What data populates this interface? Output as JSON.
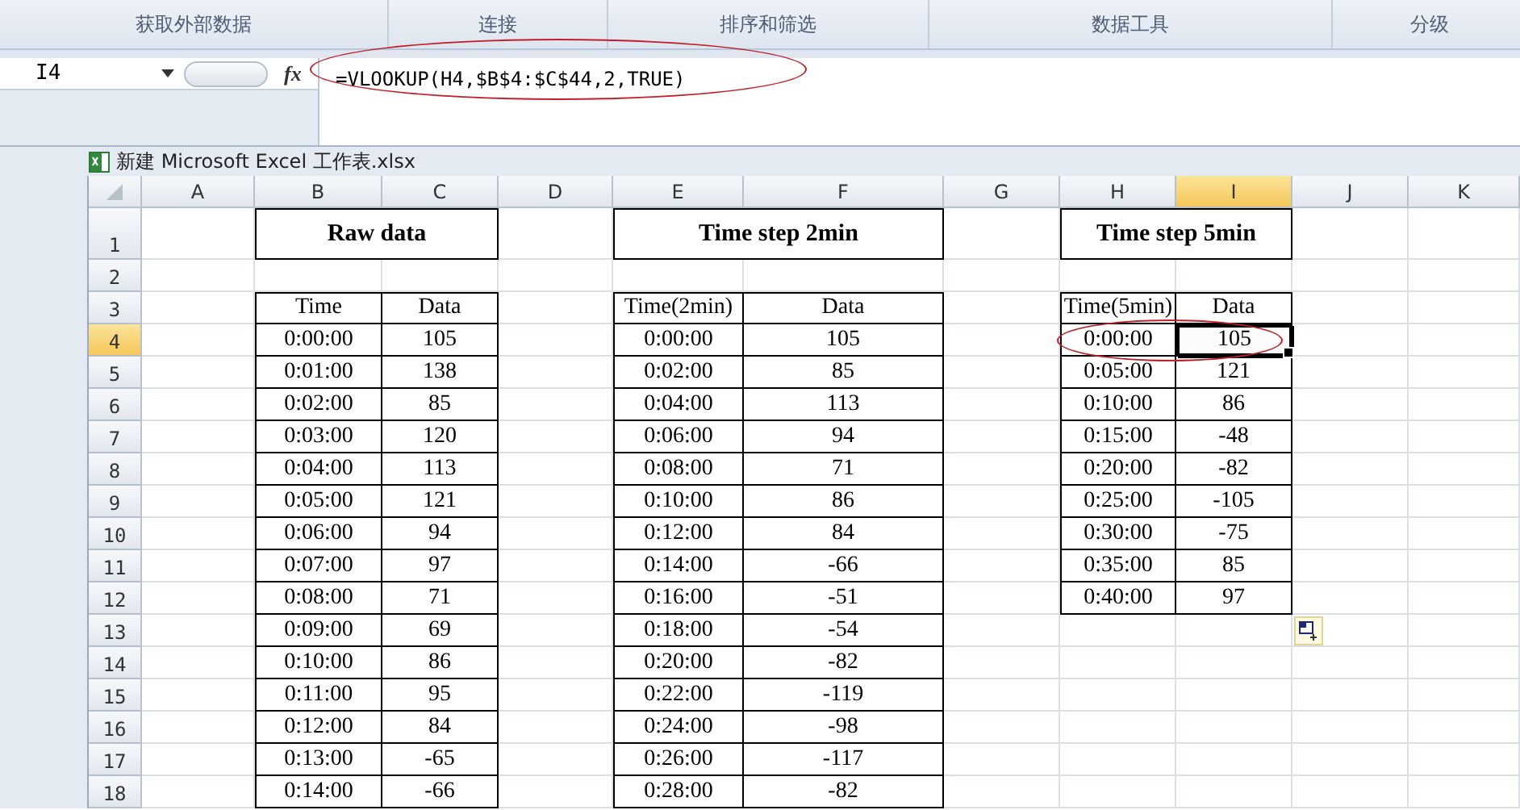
{
  "ribbon_groups": [
    "获取外部数据",
    "连接",
    "排序和筛选",
    "数据工具",
    "分级"
  ],
  "formula_bar": {
    "name_box": "I4",
    "function_label": "fx",
    "formula": "=VLOOKUP(H4,$B$4:$C$44,2,TRUE)",
    "circled": true
  },
  "workbook_title": "新建 Microsoft Excel 工作表.xlsx",
  "sheet": {
    "columns": [
      {
        "label": "A",
        "selected": false
      },
      {
        "label": "B",
        "selected": false
      },
      {
        "label": "C",
        "selected": false
      },
      {
        "label": "D",
        "selected": false
      },
      {
        "label": "E",
        "selected": false
      },
      {
        "label": "F",
        "selected": false
      },
      {
        "label": "G",
        "selected": false
      },
      {
        "label": "H",
        "selected": false
      },
      {
        "label": "I",
        "selected": true
      },
      {
        "label": "J",
        "selected": false
      },
      {
        "label": "K",
        "selected": false
      }
    ],
    "rows": [
      {
        "label": "1",
        "selected": false
      },
      {
        "label": "2",
        "selected": false
      },
      {
        "label": "3",
        "selected": false
      },
      {
        "label": "4",
        "selected": true
      },
      {
        "label": "5",
        "selected": false
      },
      {
        "label": "6",
        "selected": false
      },
      {
        "label": "7",
        "selected": false
      },
      {
        "label": "8",
        "selected": false
      },
      {
        "label": "9",
        "selected": false
      },
      {
        "label": "10",
        "selected": false
      },
      {
        "label": "11",
        "selected": false
      },
      {
        "label": "12",
        "selected": false
      },
      {
        "label": "13",
        "selected": false
      },
      {
        "label": "14",
        "selected": false
      },
      {
        "label": "15",
        "selected": false
      },
      {
        "label": "16",
        "selected": false
      },
      {
        "label": "17",
        "selected": false
      },
      {
        "label": "18",
        "selected": false
      }
    ],
    "tables": [
      {
        "title": "Raw data",
        "headers": [
          "Time",
          "Data"
        ],
        "rows": [
          {
            "time": "0:00:00",
            "data": "105",
            "circled": false,
            "data_selected": false
          },
          {
            "time": "0:01:00",
            "data": "138",
            "circled": false,
            "data_selected": false
          },
          {
            "time": "0:02:00",
            "data": "85",
            "circled": false,
            "data_selected": false
          },
          {
            "time": "0:03:00",
            "data": "120",
            "circled": false,
            "data_selected": false
          },
          {
            "time": "0:04:00",
            "data": "113",
            "circled": false,
            "data_selected": false
          },
          {
            "time": "0:05:00",
            "data": "121",
            "circled": false,
            "data_selected": false
          },
          {
            "time": "0:06:00",
            "data": "94",
            "circled": false,
            "data_selected": false
          },
          {
            "time": "0:07:00",
            "data": "97",
            "circled": false,
            "data_selected": false
          },
          {
            "time": "0:08:00",
            "data": "71",
            "circled": false,
            "data_selected": false
          },
          {
            "time": "0:09:00",
            "data": "69",
            "circled": false,
            "data_selected": false
          },
          {
            "time": "0:10:00",
            "data": "86",
            "circled": false,
            "data_selected": false
          },
          {
            "time": "0:11:00",
            "data": "95",
            "circled": false,
            "data_selected": false
          },
          {
            "time": "0:12:00",
            "data": "84",
            "circled": false,
            "data_selected": false
          },
          {
            "time": "0:13:00",
            "data": "-65",
            "circled": false,
            "data_selected": false
          },
          {
            "time": "0:14:00",
            "data": "-66",
            "circled": false,
            "data_selected": false
          }
        ]
      },
      {
        "title": "Time step 2min",
        "headers": [
          "Time(2min)",
          "Data"
        ],
        "rows": [
          {
            "time": "0:00:00",
            "data": "105",
            "circled": false,
            "data_selected": false
          },
          {
            "time": "0:02:00",
            "data": "85",
            "circled": false,
            "data_selected": false
          },
          {
            "time": "0:04:00",
            "data": "113",
            "circled": false,
            "data_selected": false
          },
          {
            "time": "0:06:00",
            "data": "94",
            "circled": false,
            "data_selected": false
          },
          {
            "time": "0:08:00",
            "data": "71",
            "circled": false,
            "data_selected": false
          },
          {
            "time": "0:10:00",
            "data": "86",
            "circled": false,
            "data_selected": false
          },
          {
            "time": "0:12:00",
            "data": "84",
            "circled": false,
            "data_selected": false
          },
          {
            "time": "0:14:00",
            "data": "-66",
            "circled": false,
            "data_selected": false
          },
          {
            "time": "0:16:00",
            "data": "-51",
            "circled": false,
            "data_selected": false
          },
          {
            "time": "0:18:00",
            "data": "-54",
            "circled": false,
            "data_selected": false
          },
          {
            "time": "0:20:00",
            "data": "-82",
            "circled": false,
            "data_selected": false
          },
          {
            "time": "0:22:00",
            "data": "-119",
            "circled": false,
            "data_selected": false
          },
          {
            "time": "0:24:00",
            "data": "-98",
            "circled": false,
            "data_selected": false
          },
          {
            "time": "0:26:00",
            "data": "-117",
            "circled": false,
            "data_selected": false
          },
          {
            "time": "0:28:00",
            "data": "-82",
            "circled": false,
            "data_selected": false
          }
        ]
      },
      {
        "title": "Time step 5min",
        "headers": [
          "Time(5min)",
          "Data"
        ],
        "rows": [
          {
            "time": "0:00:00",
            "data": "105",
            "circled": true,
            "data_selected": true
          },
          {
            "time": "0:05:00",
            "data": "121",
            "circled": false,
            "data_selected": false
          },
          {
            "time": "0:10:00",
            "data": "86",
            "circled": false,
            "data_selected": false
          },
          {
            "time": "0:15:00",
            "data": "-48",
            "circled": false,
            "data_selected": false
          },
          {
            "time": "0:20:00",
            "data": "-82",
            "circled": false,
            "data_selected": false
          },
          {
            "time": "0:25:00",
            "data": "-105",
            "circled": false,
            "data_selected": false
          },
          {
            "time": "0:30:00",
            "data": "-75",
            "circled": false,
            "data_selected": false
          },
          {
            "time": "0:35:00",
            "data": "85",
            "circled": false,
            "data_selected": false
          },
          {
            "time": "0:40:00",
            "data": "97",
            "circled": false,
            "data_selected": false
          }
        ]
      }
    ]
  }
}
